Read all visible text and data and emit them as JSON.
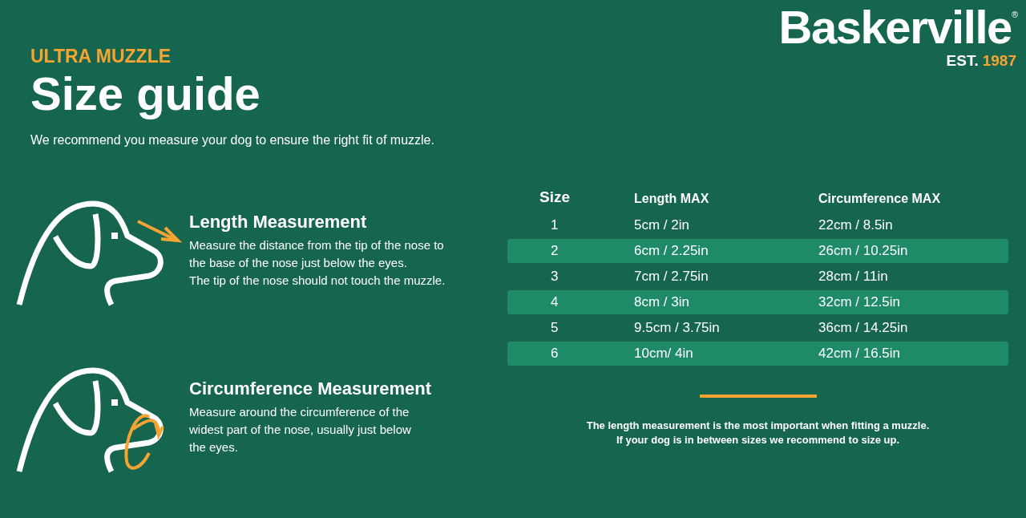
{
  "brand": {
    "name": "Baskerville",
    "mark": "®",
    "est_label": "EST.",
    "est_year": "1987"
  },
  "eyebrow": "ULTRA MUZZLE",
  "title": "Size guide",
  "intro": "We recommend you measure your dog to ensure the right fit of muzzle.",
  "measurements": [
    {
      "kind": "length",
      "title": "Length Measurement",
      "lines": [
        "Measure the distance from the tip of the nose to",
        "the base of the nose just below the eyes.",
        "The tip of the nose should not touch the muzzle."
      ]
    },
    {
      "kind": "circumference",
      "title": "Circumference Measurement",
      "lines": [
        "Measure around the circumference of the",
        "widest part of the nose, usually just below",
        "the eyes."
      ]
    }
  ],
  "table": {
    "columns": [
      "Size",
      "Length MAX",
      "Circumference MAX"
    ],
    "rows": [
      {
        "cells": [
          "1",
          "5cm / 2in",
          "22cm / 8.5in"
        ],
        "shaded": false
      },
      {
        "cells": [
          "2",
          "6cm / 2.25in",
          "26cm / 10.25in"
        ],
        "shaded": true
      },
      {
        "cells": [
          "3",
          "7cm / 2.75in",
          "28cm / 11in"
        ],
        "shaded": false
      },
      {
        "cells": [
          "4",
          "8cm / 3in",
          "32cm / 12.5in"
        ],
        "shaded": true
      },
      {
        "cells": [
          "5",
          "9.5cm / 3.75in",
          "36cm / 14.25in"
        ],
        "shaded": false
      },
      {
        "cells": [
          "6",
          "10cm/ 4in",
          "42cm / 16.5in"
        ],
        "shaded": true
      }
    ]
  },
  "note": [
    "The length measurement is the most important when fitting a muzzle.",
    "If your dog is in between sizes we recommend to size up."
  ]
}
